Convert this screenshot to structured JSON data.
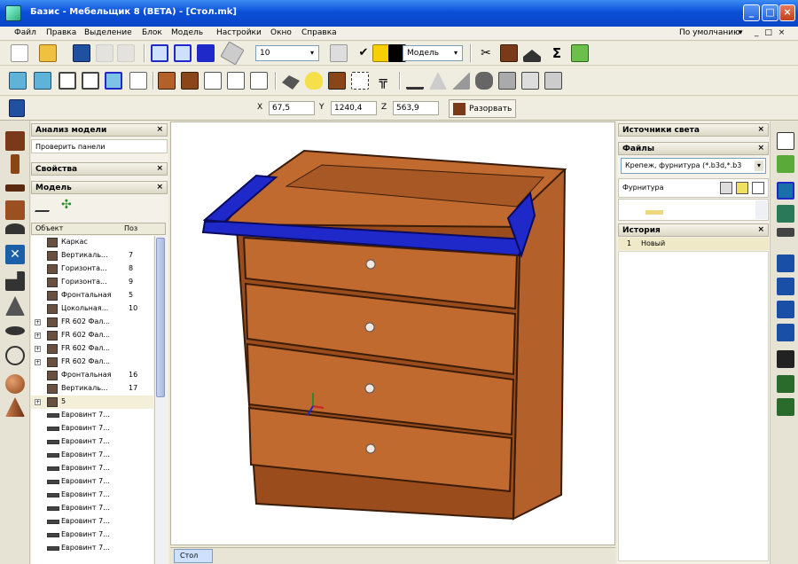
{
  "window": {
    "title": "Базис - Мебельщик 8 (BETA) - [Стол.mk]",
    "min": "_",
    "max": "□",
    "close": "×"
  },
  "menu": {
    "items": [
      "Файл",
      "Правка",
      "Выделение",
      "Блок",
      "Модель",
      "Настройки",
      "Окно",
      "Справка"
    ],
    "right_label": "По умолчанию",
    "right_arrow": "▾",
    "mdi_controls": "_ □ ×"
  },
  "toolbar1": {
    "thickness_value": "10",
    "material_label": "Модель"
  },
  "coords": {
    "x_label": "X",
    "x_value": "67,5",
    "y_label": "Y",
    "y_value": "1240,4",
    "z_label": "Z",
    "z_value": "563,9",
    "action_button": "Разорвать"
  },
  "left_panel": {
    "analysis_title": "Анализ модели",
    "check_panels": "Проверить панели",
    "properties_title": "Свойства",
    "model_title": "Модель",
    "col_object": "Объект",
    "col_pos": "Поз",
    "rows": [
      {
        "label": "Каркас",
        "num": "",
        "icon": "panel",
        "exp": ""
      },
      {
        "label": "Вертикаль...",
        "num": "7",
        "icon": "panel",
        "exp": ""
      },
      {
        "label": "Горизонта...",
        "num": "8",
        "icon": "panel",
        "exp": ""
      },
      {
        "label": "Горизонта...",
        "num": "9",
        "icon": "panel",
        "exp": ""
      },
      {
        "label": "Фронтальная",
        "num": "5",
        "icon": "panel",
        "exp": ""
      },
      {
        "label": "Цокольная...",
        "num": "10",
        "icon": "panel",
        "exp": ""
      },
      {
        "label": "FR 602 Фал...",
        "num": "",
        "icon": "panel",
        "exp": "+"
      },
      {
        "label": "FR 602 Фал...",
        "num": "",
        "icon": "panel",
        "exp": "+"
      },
      {
        "label": "FR 602 Фал...",
        "num": "",
        "icon": "panel",
        "exp": "+"
      },
      {
        "label": "FR 602 Фал...",
        "num": "",
        "icon": "panel",
        "exp": "+"
      },
      {
        "label": "Фронтальная",
        "num": "16",
        "icon": "panel",
        "exp": ""
      },
      {
        "label": "Вертикаль...",
        "num": "17",
        "icon": "panel",
        "exp": ""
      },
      {
        "label": "5",
        "num": "",
        "icon": "panel",
        "exp": "+"
      },
      {
        "label": "Евровинт 7...",
        "num": "",
        "icon": "screw",
        "exp": ""
      },
      {
        "label": "Евровинт 7...",
        "num": "",
        "icon": "screw",
        "exp": ""
      },
      {
        "label": "Евровинт 7...",
        "num": "",
        "icon": "screw",
        "exp": ""
      },
      {
        "label": "Евровинт 7...",
        "num": "",
        "icon": "screw",
        "exp": ""
      },
      {
        "label": "Евровинт 7...",
        "num": "",
        "icon": "screw",
        "exp": ""
      },
      {
        "label": "Евровинт 7...",
        "num": "",
        "icon": "screw",
        "exp": ""
      },
      {
        "label": "Евровинт 7...",
        "num": "",
        "icon": "screw",
        "exp": ""
      },
      {
        "label": "Евровинт 7...",
        "num": "",
        "icon": "screw",
        "exp": ""
      },
      {
        "label": "Евровинт 7...",
        "num": "",
        "icon": "screw",
        "exp": ""
      },
      {
        "label": "Евровинт 7...",
        "num": "",
        "icon": "screw",
        "exp": ""
      },
      {
        "label": "Евровинт 7...",
        "num": "",
        "icon": "screw",
        "exp": ""
      }
    ]
  },
  "right_panel": {
    "light_title": "Источники света",
    "files_title": "Файлы",
    "files_combo": "Крепеж, фурнитура (*.b3d,*.b3",
    "fittings_label": "Фурнитура",
    "history_title": "История",
    "history_item_num": "1",
    "history_item_label": "Новый"
  },
  "bottom": {
    "tab_label": "Стол"
  },
  "colors": {
    "wood": "#b4602a",
    "wood_dark": "#8a4518",
    "selection": "#1f28c8",
    "edge": "#3a1c08",
    "titlebar": "#0a4fd8"
  }
}
